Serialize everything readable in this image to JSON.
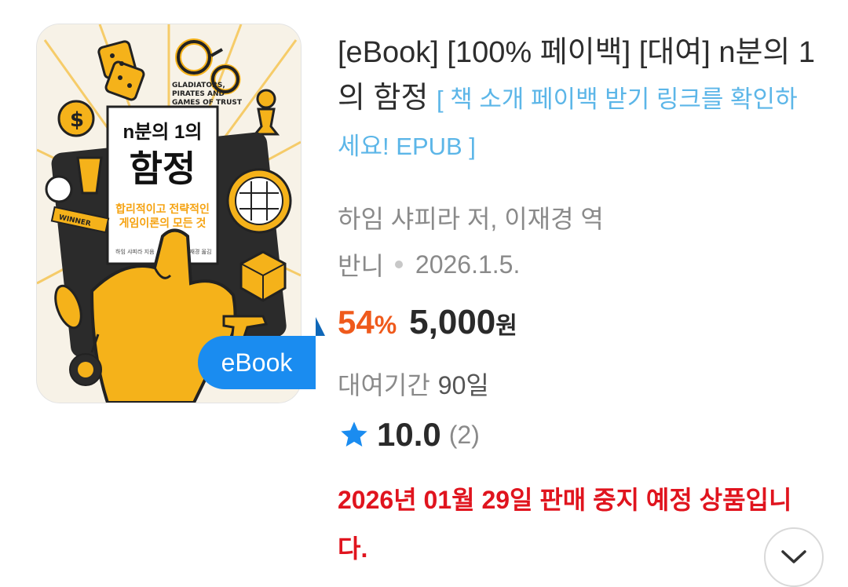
{
  "book": {
    "title_main": "[eBook] [100% 페이백] [대여] n분의 1의 함정",
    "title_link": "[ 책 소개 페이백 받기 링크를 확인하세요! EPUB ]",
    "author": "하임 샤피라 저, 이재경 역",
    "publisher": "반니",
    "date": "2026.1.5.",
    "discount": "54",
    "discount_unit": "%",
    "price": "5,000",
    "price_unit": "원",
    "rental_label": "대여기간",
    "rental_value": "90일",
    "rating": "10.0",
    "rating_count": "(2)",
    "notice": "2026년 01월 29일 판매 중지 예정 상품입니다."
  },
  "cover": {
    "title_line1": "n분의 1의",
    "title_line2": "함정",
    "subtitle_line1": "합리적이고 전략적인",
    "subtitle_line2": "게임이론의 모든 것",
    "en_line1": "GLADIATORS,",
    "en_line2": "PIRATES AND",
    "en_line3": "GAMES OF TRUST",
    "author_small": "하임 샤피라 지음",
    "translator_small": "이재경 옮김",
    "winner": "WINNER"
  },
  "badge": {
    "label": "eBook"
  },
  "colors": {
    "accent_blue": "#1a8cf0",
    "discount_orange": "#ef5a1c",
    "notice_red": "#e0141e",
    "link_blue": "#5cb6e8",
    "cover_yellow": "#f5b21a"
  },
  "icons": {
    "star": "star-icon",
    "expand": "chevron-down-icon"
  }
}
